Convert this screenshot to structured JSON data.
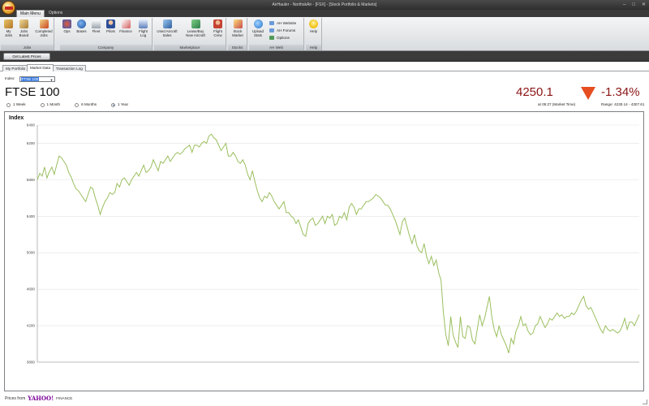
{
  "window": {
    "title": "AirHauler - NorthskAir - [FSX] - [Stock Portfolio & Markets]",
    "controls": [
      "–",
      "□",
      "✕"
    ]
  },
  "ribbon_tabs": [
    "Main Menu",
    "Options"
  ],
  "ribbon": {
    "groups": [
      {
        "label": "Jobs",
        "buttons": [
          "My\nJobs",
          "Jobs\nBoard",
          "Completed\nJobs"
        ]
      },
      {
        "label": "Company",
        "buttons": [
          "Ops",
          "Bases",
          "Fleet",
          "Pilots",
          "Finance",
          "Flight\nLog"
        ]
      },
      {
        "label": "Marketplace",
        "buttons": [
          "Used Aircraft\nSales",
          "Lease/Buy\nNew Aircraft",
          "Flight\nCrew"
        ]
      },
      {
        "label": "Stocks",
        "buttons": [
          "Stock\nMarket"
        ]
      },
      {
        "label": "AH Web",
        "buttons": [
          "Upload\nStats"
        ],
        "links": [
          "AH Website",
          "AH Forums",
          "Options"
        ]
      },
      {
        "label": "Help",
        "buttons": [
          "Help"
        ]
      }
    ]
  },
  "toolstrip": {
    "get_prices": "Get Latest Prices"
  },
  "subtabs": [
    "My Portfolio",
    "Market Data",
    "Transaction Log"
  ],
  "index_label": "Index:",
  "index_value": "FTSE 100",
  "name": "FTSE 100",
  "ranges": [
    "1 Week",
    "1 Month",
    "6 Months",
    "1 Year"
  ],
  "selected_range": "1 Year",
  "quote": {
    "price": "4250.1",
    "change": "-1.34%",
    "time": "at 05:27 (Market Time)",
    "range": "Range: 4230.14 - 4307.61",
    "direction": "down",
    "color": "#8c1414"
  },
  "provider": {
    "label": "Prices from",
    "brand": "YAHOO!",
    "suffix": "FINANCE"
  },
  "chart_data": {
    "type": "line",
    "title": "Index",
    "xlabel": "",
    "ylabel": "",
    "ylim": [
      3800,
      6400
    ],
    "yticks": [
      3800,
      4200,
      4600,
      5000,
      5400,
      5800,
      6200,
      6400
    ],
    "grid": true,
    "line_color": "#9bbf5f",
    "x": [
      0,
      1,
      2,
      3,
      4,
      5,
      6,
      7,
      8,
      9,
      10,
      11,
      12,
      13,
      14,
      15,
      16,
      17,
      18,
      19,
      20,
      21,
      22,
      23,
      24,
      25,
      26,
      27,
      28,
      29,
      30,
      31,
      32,
      33,
      34,
      35,
      36,
      37,
      38,
      39,
      40,
      41,
      42,
      43,
      44,
      45,
      46,
      47,
      48,
      49,
      50,
      51,
      52,
      53,
      54,
      55,
      56,
      57,
      58,
      59,
      60,
      61,
      62,
      63,
      64,
      65,
      66,
      67,
      68,
      69,
      70,
      71,
      72,
      73,
      74,
      75,
      76,
      77,
      78,
      79,
      80,
      81,
      82,
      83,
      84,
      85,
      86,
      87,
      88,
      89,
      90,
      91,
      92,
      93,
      94,
      95,
      96,
      97,
      98,
      99,
      100,
      101,
      102,
      103,
      104,
      105,
      106,
      107,
      108,
      109,
      110,
      111,
      112,
      113,
      114,
      115,
      116,
      117,
      118,
      119,
      120,
      121,
      122,
      123,
      124,
      125,
      126,
      127,
      128,
      129,
      130,
      131,
      132,
      133,
      134,
      135,
      136,
      137,
      138,
      139,
      140,
      141,
      142,
      143,
      144,
      145,
      146,
      147,
      148,
      149,
      150,
      151,
      152,
      153,
      154,
      155,
      156,
      157,
      158,
      159,
      160,
      161,
      162,
      163,
      164,
      165,
      166,
      167,
      168,
      169,
      170,
      171,
      172,
      173,
      174,
      175,
      176,
      177,
      178,
      179,
      180,
      181,
      182,
      183,
      184,
      185,
      186,
      187,
      188,
      189,
      190,
      191,
      192,
      193,
      194,
      195,
      196,
      197,
      198,
      199,
      200,
      201,
      202,
      203,
      204,
      205,
      206,
      207,
      208,
      209,
      210,
      211,
      212,
      213,
      214,
      215,
      216,
      217,
      218,
      219,
      220,
      221,
      222,
      223,
      224,
      225,
      226,
      227,
      228,
      229,
      230,
      231,
      232,
      233,
      234,
      235,
      236,
      237,
      238,
      239,
      240,
      241,
      242,
      243,
      244,
      245,
      246,
      247,
      248,
      249
    ],
    "values": [
      5800,
      5870,
      5840,
      5940,
      5820,
      5890,
      5940,
      5860,
      5960,
      6060,
      6040,
      6000,
      5960,
      5880,
      5830,
      5760,
      5700,
      5680,
      5640,
      5600,
      5560,
      5640,
      5720,
      5700,
      5600,
      5520,
      5420,
      5500,
      5560,
      5600,
      5660,
      5640,
      5660,
      5760,
      5720,
      5800,
      5820,
      5780,
      5740,
      5800,
      5840,
      5880,
      5840,
      5900,
      5960,
      5880,
      5900,
      5940,
      6020,
      5960,
      5900,
      6000,
      5980,
      6020,
      6060,
      6000,
      6040,
      6080,
      6100,
      6080,
      6100,
      6140,
      6160,
      6180,
      6100,
      6180,
      6180,
      6160,
      6200,
      6220,
      6200,
      6280,
      6300,
      6260,
      6240,
      6180,
      6120,
      6160,
      6200,
      6060,
      6060,
      6100,
      6060,
      6000,
      5980,
      6020,
      5960,
      5860,
      5800,
      5900,
      5780,
      5680,
      5600,
      5560,
      5620,
      5600,
      5660,
      5620,
      5560,
      5520,
      5480,
      5520,
      5560,
      5440,
      5440,
      5400,
      5380,
      5320,
      5360,
      5280,
      5200,
      5180,
      5320,
      5360,
      5380,
      5300,
      5320,
      5360,
      5400,
      5320,
      5400,
      5380,
      5420,
      5300,
      5320,
      5400,
      5380,
      5440,
      5360,
      5500,
      5540,
      5500,
      5420,
      5480,
      5480,
      5520,
      5560,
      5560,
      5580,
      5600,
      5640,
      5620,
      5600,
      5560,
      5520,
      5520,
      5480,
      5420,
      5360,
      5280,
      5200,
      5340,
      5380,
      5280,
      5180,
      5100,
      5200,
      5080,
      5020,
      5000,
      5100,
      4960,
      4880,
      4960,
      4860,
      4920,
      4780,
      4700,
      4340,
      4100,
      3980,
      4300,
      4100,
      4020,
      3960,
      4300,
      4080,
      4060,
      4200,
      4180,
      4040,
      4000,
      4160,
      4320,
      4200,
      4280,
      4400,
      4520,
      4300,
      4160,
      4080,
      4200,
      4100,
      4040,
      3980,
      3900,
      4060,
      4000,
      4140,
      4200,
      4300,
      4200,
      4220,
      4140,
      4100,
      4120,
      4200,
      4220,
      4300,
      4240,
      4180,
      4220,
      4280,
      4260,
      4300,
      4340,
      4300,
      4320,
      4280,
      4300,
      4300,
      4340,
      4320,
      4360,
      4420,
      4480,
      4520,
      4420,
      4380,
      4400,
      4340,
      4280,
      4220,
      4160,
      4120,
      4200,
      4160,
      4140,
      4160,
      4140,
      4120,
      4140,
      4200,
      4280,
      4160,
      4240,
      4240,
      4200,
      4260,
      4320,
      4300,
      4300
    ]
  }
}
